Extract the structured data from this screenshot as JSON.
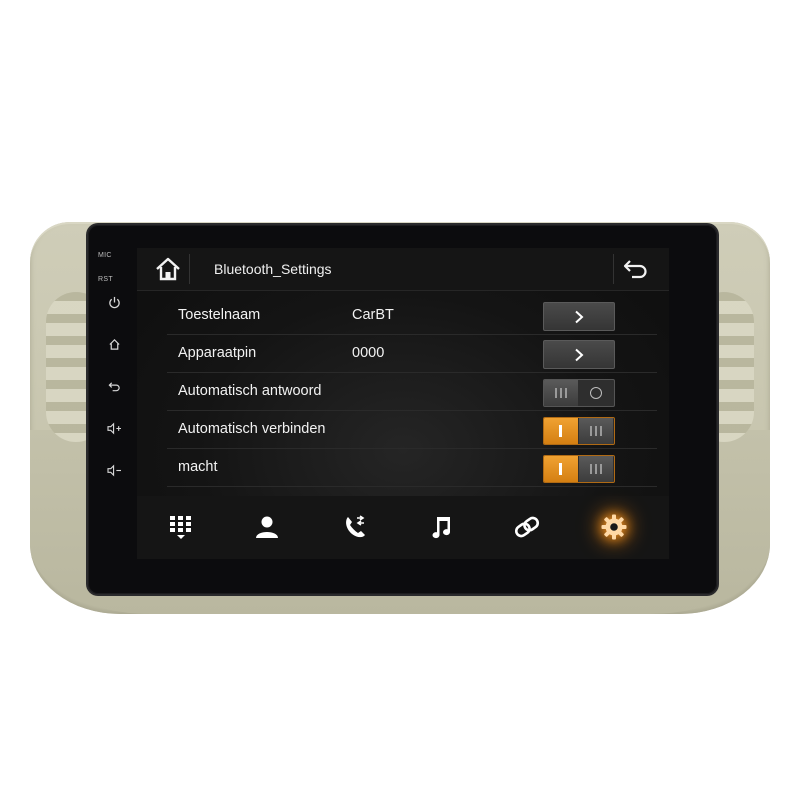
{
  "window": {
    "title": "Bluetooth_Settings"
  },
  "side_panel": {
    "mic_label": "MIC",
    "rst_label": "RST"
  },
  "settings": [
    {
      "label": "Toestelnaam",
      "value": "CarBT",
      "control": "arrow"
    },
    {
      "label": "Apparaatpin",
      "value": "0000",
      "control": "arrow"
    },
    {
      "label": "Automatisch antwoord",
      "value": "",
      "control": "toggle",
      "enabled": false
    },
    {
      "label": "Automatisch verbinden",
      "value": "",
      "control": "toggle",
      "enabled": true
    },
    {
      "label": "macht",
      "value": "",
      "control": "toggle",
      "enabled": true
    }
  ],
  "bottom_tabs": [
    {
      "icon": "dialpad-icon",
      "active": false
    },
    {
      "icon": "contacts-icon",
      "active": false
    },
    {
      "icon": "call-log-icon",
      "active": false
    },
    {
      "icon": "music-icon",
      "active": false
    },
    {
      "icon": "link-icon",
      "active": false
    },
    {
      "icon": "settings-gear-icon",
      "active": true
    }
  ],
  "colors": {
    "accent": "#e8921f",
    "screen_bg": "#141414",
    "bezel": "#c9c7b0",
    "text": "#f2f2f2"
  }
}
